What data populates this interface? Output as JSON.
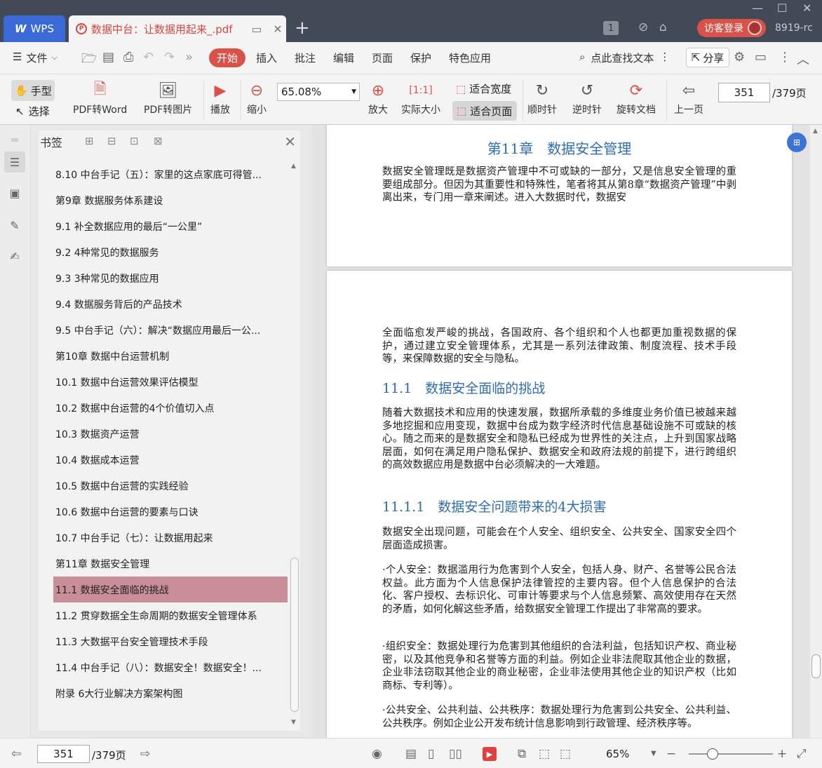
{
  "app": {
    "name": "WPS",
    "user_login": "访客登录",
    "user_id": "8919-rc",
    "page_badge": "1"
  },
  "tab": {
    "title": "数据中台：让数据用起来_.pdf"
  },
  "menu": {
    "file": "文件",
    "start": "开始",
    "items": [
      "插入",
      "批注",
      "编辑",
      "页面",
      "保护",
      "特色应用"
    ],
    "search": "点此查找文本",
    "share": "分享"
  },
  "toolbar": {
    "hand": "手型",
    "select": "选择",
    "pdf_to_word": "PDF转Word",
    "pdf_to_image": "PDF转图片",
    "play": "播放",
    "zoom_out": "缩小",
    "zoom_value": "65.08%",
    "zoom_in": "放大",
    "actual_size": "实际大小",
    "fit_width": "适合宽度",
    "fit_page": "适合页面",
    "rotate_cw": "顺时针",
    "rotate_ccw": "逆时针",
    "rotate_doc": "旋转文档",
    "prev_page": "上一页",
    "current_page": "351",
    "total_pages": "/379页"
  },
  "bookmarks": {
    "title": "书签",
    "items": [
      "8.10 中台手记（五）：家里的这点家底可得管...",
      "第9章 数据服务体系建设",
      "9.1 补全数据应用的最后“一公里”",
      "9.2 4种常见的数据服务",
      "9.3 3种常见的数据应用",
      "9.4 数据服务背后的产品技术",
      "9.5 中台手记（六）：解决“数据应用最后一公...",
      "第10章 数据中台运营机制",
      "10.1 数据中台运营效果评估模型",
      "10.2 数据中台运营的4个价值切入点",
      "10.3 数据资产运营",
      "10.4 数据成本运营",
      "10.5 数据中台运营的实践经验",
      "10.6 数据中台运营的要素与口诀",
      "10.7 中台手记（七）：让数据用起来",
      "第11章 数据安全管理",
      "11.1 数据安全面临的挑战",
      "11.2 贯穿数据全生命周期的数据安全管理体系",
      "11.3 大数据平台安全管理技术手段",
      "11.4 中台手记（八）：数据安全！数据安全！...",
      "附录 6大行业解决方案架构图"
    ],
    "selected_index": 16
  },
  "document": {
    "chapter_title": "第11章　数据安全管理",
    "p1": "数据安全管理既是数据资产管理中不可或缺的一部分，又是信息安全管理的重要组成部分。但因为其重要性和特殊性，笔者将其从第8章“数据资产管理”中剥离出来，专门用一章来阐述。进入大数据时代，数据安",
    "p2": "全面临愈发严峻的挑战，各国政府、各个组织和个人也都更加重视数据的保护，通过建立安全管理体系，尤其是一系列法律政策、制度流程、技术手段等，来保障数据的安全与隐私。",
    "h_11_1": "11.1　数据安全面临的挑战",
    "p3": "随着大数据技术和应用的快速发展，数据所承载的多维度业务价值已被越来越多地挖掘和应用变现，数据中台成为数字经济时代信息基础设施不可或缺的核心。随之而来的是数据安全和隐私已经成为世界性的关注点，上升到国家战略层面，如何在满足用户隐私保护、数据安全和政府法规的前提下，进行跨组织的高效数据应用是数据中台必须解决的一大难题。",
    "h_11_1_1": "11.1.1　数据安全问题带来的4大损害",
    "p4": "数据安全出现问题，可能会在个人安全、组织安全、公共安全、国家安全四个层面造成损害。",
    "p5": "·个人安全：数据滥用行为危害到个人安全，包括人身、财产、名誉等公民合法权益。此方面为个人信息保护法律管控的主要内容。但个人信息保护的合法化、客户授权、去标识化、可审计等要求与个人信息频繁、高效使用存在天然的矛盾，如何化解这些矛盾，给数据安全管理工作提出了非常高的要求。",
    "p6": "·组织安全：数据处理行为危害到其他组织的合法利益，包括知识产权、商业秘密，以及其他竞争和名誉等方面的利益。例如企业非法爬取其他企业的数据，企业非法窃取其他企业的商业秘密，企业非法使用其他企业的知识产权（比如商标、专利等）。",
    "p7": "·公共安全、公共利益、公共秩序：数据处理行为危害到公共安全、公共利益、公共秩序。例如企业公开发布统计信息影响到行政管理、经济秩序等。"
  },
  "status": {
    "current_page": "351",
    "total_pages": "/379页",
    "zoom": "65%"
  },
  "colors": {
    "accent": "#d9524a",
    "heading": "#2f6db3",
    "titlebar": "#424a57",
    "selection": "#c98f98"
  }
}
